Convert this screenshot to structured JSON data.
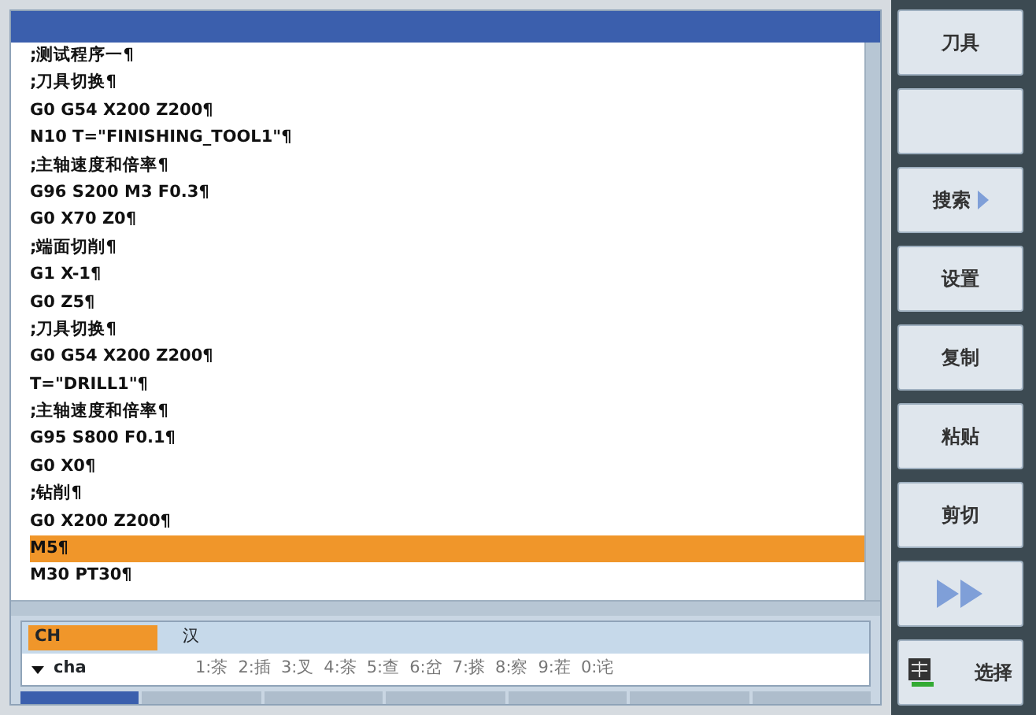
{
  "editor": {
    "lines": [
      {
        "text": ";测试程序一¶",
        "selected": false
      },
      {
        "text": ";刀具切换¶",
        "selected": false
      },
      {
        "text": "G0 G54 X200 Z200¶",
        "selected": false
      },
      {
        "text": "N10 T=\"FINISHING_TOOL1\"¶",
        "selected": false
      },
      {
        "text": ";主轴速度和倍率¶",
        "selected": false
      },
      {
        "text": "G96 S200 M3 F0.3¶",
        "selected": false
      },
      {
        "text": "G0 X70 Z0¶",
        "selected": false
      },
      {
        "text": ";端面切削¶",
        "selected": false
      },
      {
        "text": "G1 X-1¶",
        "selected": false
      },
      {
        "text": "G0 Z5¶",
        "selected": false
      },
      {
        "text": ";刀具切换¶",
        "selected": false
      },
      {
        "text": "G0 G54 X200 Z200¶",
        "selected": false
      },
      {
        "text": "T=\"DRILL1\"¶",
        "selected": false
      },
      {
        "text": ";主轴速度和倍率¶",
        "selected": false
      },
      {
        "text": "G95 S800 F0.1¶",
        "selected": false
      },
      {
        "text": "G0 X0¶",
        "selected": false
      },
      {
        "text": ";钻削¶",
        "selected": false
      },
      {
        "text": "G0 X200 Z200¶",
        "selected": false
      },
      {
        "text": "M5¶",
        "selected": true
      },
      {
        "text": "M30 PT30¶",
        "selected": false
      }
    ]
  },
  "ime": {
    "mode": "CH",
    "script": "汉",
    "pinyin": "cha",
    "candidates": [
      "1:茶",
      "2:插",
      "3:叉",
      "4:茶",
      "5:查",
      "6:岔",
      "7:搽",
      "8:察",
      "9:茬",
      "0:诧"
    ]
  },
  "tabs": [
    {
      "selected": true
    },
    {
      "selected": false
    },
    {
      "selected": false
    },
    {
      "selected": false
    },
    {
      "selected": false
    },
    {
      "selected": false
    },
    {
      "selected": false
    }
  ],
  "softkeys": [
    {
      "kind": "text",
      "label": "刀具"
    },
    {
      "kind": "empty"
    },
    {
      "kind": "submenu",
      "label": "搜索"
    },
    {
      "kind": "text",
      "label": "设置"
    },
    {
      "kind": "text",
      "label": "复制"
    },
    {
      "kind": "text",
      "label": "粘贴"
    },
    {
      "kind": "text",
      "label": "剪切"
    },
    {
      "kind": "more"
    },
    {
      "kind": "select",
      "label": "选择"
    }
  ]
}
